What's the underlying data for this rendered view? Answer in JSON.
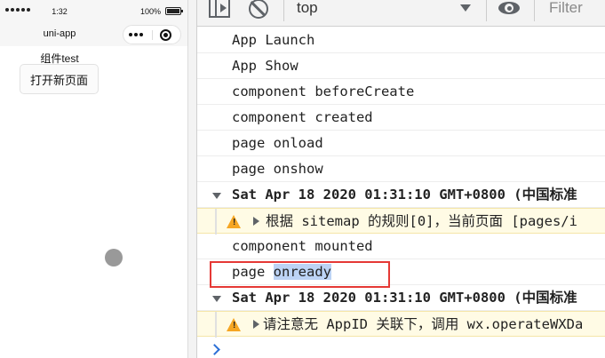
{
  "simulator": {
    "status_time": "1:32",
    "battery": "100%",
    "nav_title": "uni-app",
    "page_text": "组件test",
    "open_button": "打开新页面"
  },
  "toolbar": {
    "context": "top",
    "filter_placeholder": "Filter",
    "icons": [
      "sidebar-toggle-icon",
      "clear-console-icon",
      "chevron-down-icon",
      "eye-icon"
    ]
  },
  "console": {
    "lines": [
      "App Launch",
      "App Show",
      "component beforeCreate",
      "component created",
      "page onload",
      "page onshow",
      "Sat Apr 18 2020 01:31:10 GMT+0800 (中国标准",
      "根据 sitemap 的规则[0]，当前页面 [pages/i",
      "component mounted",
      "page onready",
      "Sat Apr 18 2020 01:31:10 GMT+0800 (中国标准",
      "请注意无 AppID 关联下，调用 wx.operateWXDa"
    ],
    "onready_prefix": "page ",
    "onready_word": "onready"
  },
  "colors": {
    "highlight_box": "#e53935",
    "warning_bg": "#fffbe5",
    "warning_icon": "#f6a623",
    "selection": "#bcd3f5",
    "prompt": "#2b6fd6"
  }
}
